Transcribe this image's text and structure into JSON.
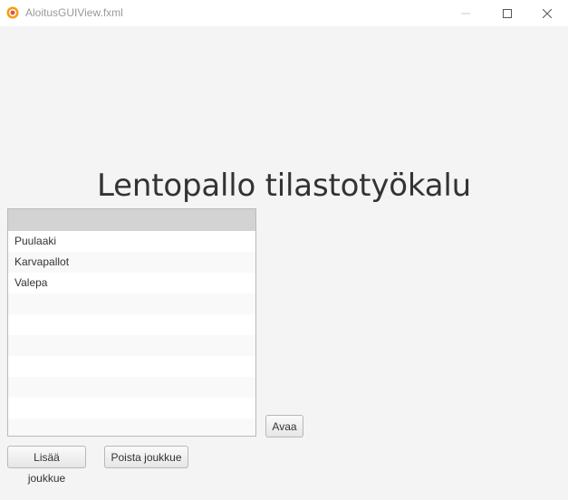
{
  "window": {
    "title": "AloitusGUIView.fxml",
    "icon": "java-app-icon",
    "controls": [
      "minimize-icon",
      "maximize-icon",
      "close-icon"
    ]
  },
  "main": {
    "heading": "Lentopallo tilastotyökalu",
    "team_list": {
      "header": "",
      "items": [
        "Puulaaki",
        "Karvapallot",
        "Valepa"
      ]
    },
    "open_button": "Avaa",
    "add_team_button": "Lisää joukkue",
    "remove_team_button": "Poista joukkue"
  },
  "colors": {
    "background": "#f4f4f4",
    "list_header": "#d3d3d3",
    "text": "#333333"
  }
}
